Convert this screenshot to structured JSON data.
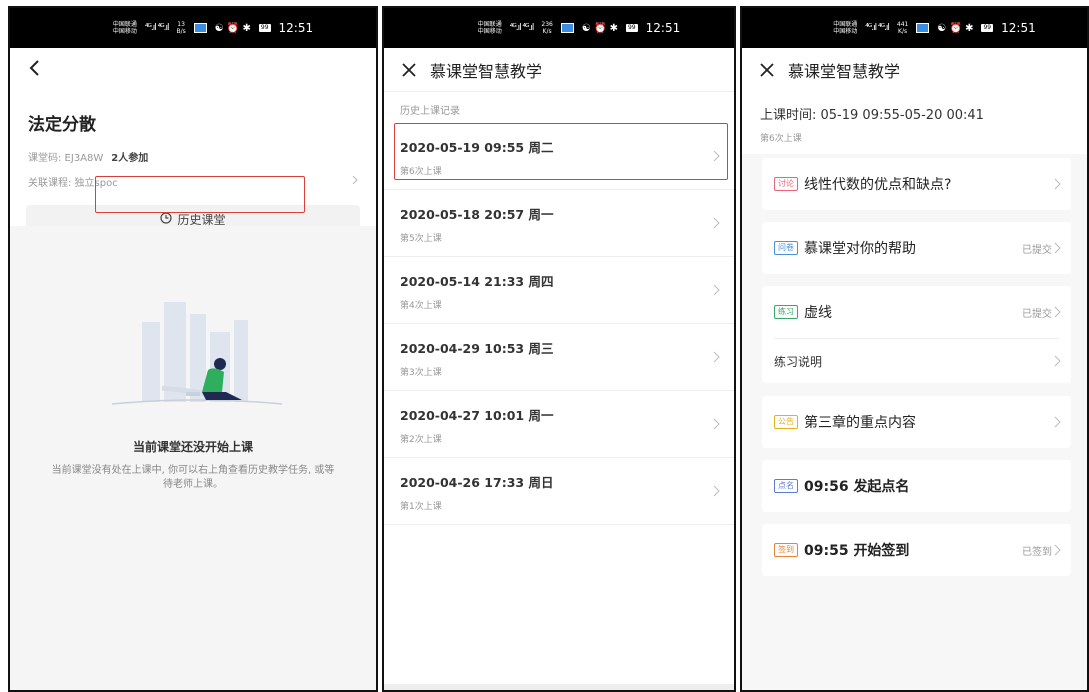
{
  "statusbar": {
    "carrier_top": "中国联通",
    "carrier_bottom": "中国移动",
    "signal": "⁴ᴳ.ıl ⁴ᴳ.ıl",
    "screens": [
      {
        "speed": "13",
        "speed_unit": "B/s"
      },
      {
        "speed": "236",
        "speed_unit": "K/s"
      },
      {
        "speed": "441",
        "speed_unit": "K/s"
      }
    ],
    "battery": "99",
    "time": "12:51"
  },
  "screen1": {
    "course_title": "法定分散",
    "code_label": "课堂码: EJ3A8W",
    "participants": "2人参加",
    "related_course": "关联课程: 独立spoc",
    "history_button": "历史课堂",
    "empty_title": "当前课堂还没开始上课",
    "empty_desc": "当前课堂没有处在上课中, 你可以右上角查看历史教学任务, 或等待老师上课。"
  },
  "screen2": {
    "title": "慕课堂智慧教学",
    "section_label": "历史上课记录",
    "sessions": [
      {
        "date": "2020-05-19 09:55 周二",
        "sub": "第6次上课"
      },
      {
        "date": "2020-05-18 20:57 周一",
        "sub": "第5次上课"
      },
      {
        "date": "2020-05-14 21:33 周四",
        "sub": "第4次上课"
      },
      {
        "date": "2020-04-29 10:53 周三",
        "sub": "第3次上课"
      },
      {
        "date": "2020-04-27 10:01 周一",
        "sub": "第2次上课"
      },
      {
        "date": "2020-04-26 17:33 周日",
        "sub": "第1次上课"
      }
    ]
  },
  "screen3": {
    "title": "慕课堂智慧教学",
    "class_time": "上课时间: 05-19 09:55-05-20 00:41",
    "class_sub": "第6次上课",
    "items": [
      {
        "tag": "讨论",
        "tag_color": "#e8647a",
        "text": "线性代数的优点和缺点?",
        "status": ""
      },
      {
        "tag": "问卷",
        "tag_color": "#4a90d9",
        "text": "慕课堂对你的帮助",
        "status": "已提交"
      },
      {
        "tag": "练习",
        "tag_color": "#3aa86b",
        "text": "虚线",
        "status": "已提交",
        "sub": "练习说明"
      },
      {
        "tag": "公告",
        "tag_color": "#e3b21a",
        "text": "第三章的重点内容",
        "status": ""
      },
      {
        "tag": "点名",
        "tag_color": "#5b7bd5",
        "text": "09:56 发起点名",
        "status": ""
      },
      {
        "tag": "签到",
        "tag_color": "#e8833a",
        "text": "09:55 开始签到",
        "status": "已签到"
      }
    ]
  },
  "colors": {
    "highlight_red": "#d9403a",
    "empty_bg": "#f5f5f5",
    "figure_green": "#2fae5e",
    "figure_navy": "#1f2a52"
  }
}
